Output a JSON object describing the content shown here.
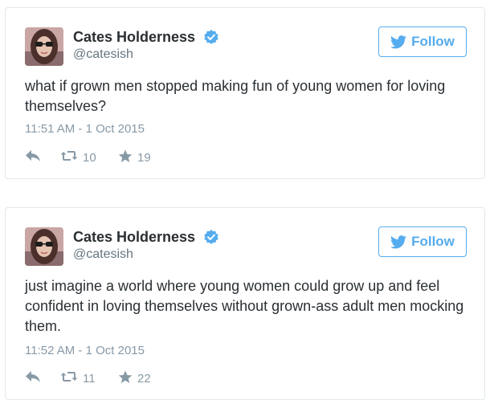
{
  "tweets": [
    {
      "name": "Cates Holderness",
      "handle": "@catesish",
      "follow_label": "Follow",
      "text": "what if grown men stopped making fun of young women for loving themselves?",
      "timestamp": "11:51 AM - 1 Oct 2015",
      "retweets": "10",
      "likes": "19"
    },
    {
      "name": "Cates Holderness",
      "handle": "@catesish",
      "follow_label": "Follow",
      "text": "just imagine a world where young women could grow up and feel confident in loving themselves without grown-ass adult men mocking them.",
      "timestamp": "11:52 AM - 1 Oct 2015",
      "retweets": "11",
      "likes": "22"
    }
  ],
  "icons": {
    "verified": "verified-badge-icon",
    "bird": "twitter-bird-icon",
    "reply": "reply-arrow-icon",
    "retweet": "retweet-icon",
    "like": "star-icon"
  },
  "colors": {
    "accent": "#55acee",
    "text": "#292f33",
    "muted": "#8899a6",
    "border": "#e1e8ed"
  }
}
